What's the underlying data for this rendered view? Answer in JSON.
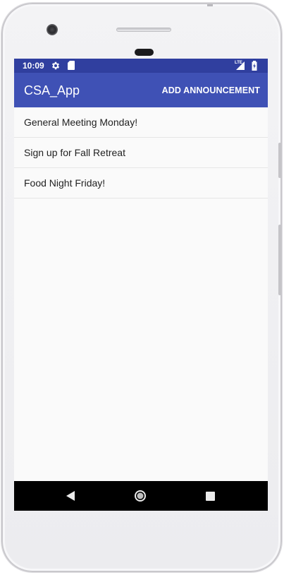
{
  "status_bar": {
    "time": "10:09",
    "network": "LTE",
    "icons": [
      "gear-icon",
      "sd-card-icon",
      "signal-icon",
      "battery-charging-icon"
    ]
  },
  "app_bar": {
    "title": "CSA_App",
    "action_label": "ADD ANNOUNCEMENT"
  },
  "announcements": [
    {
      "text": "General Meeting Monday!"
    },
    {
      "text": "Sign up for Fall Retreat"
    },
    {
      "text": "Food Night Friday!"
    }
  ],
  "nav_bar": {
    "icons": [
      "back-icon",
      "home-icon",
      "recent-apps-icon"
    ]
  },
  "colors": {
    "primary": "#3f51b5",
    "primary_dark": "#303f9f",
    "background": "#fafafa",
    "divider": "#e6e6e6",
    "nav_bar": "#000000"
  }
}
